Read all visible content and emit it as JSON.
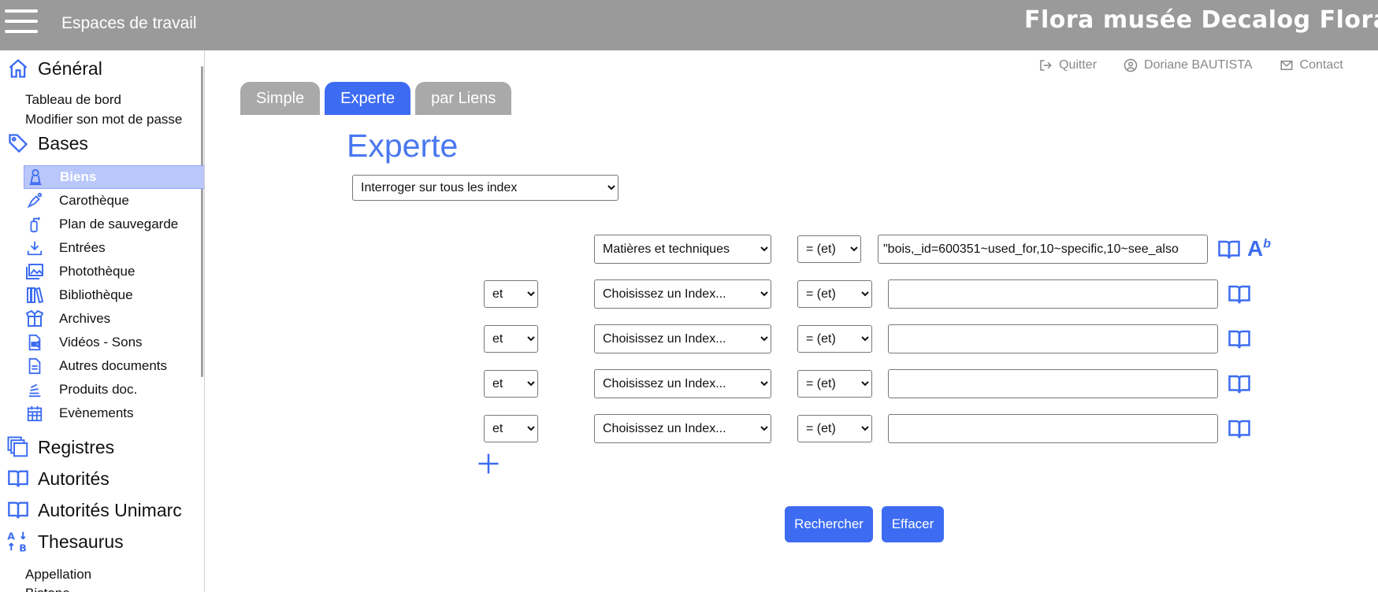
{
  "header": {
    "workspaces_label": "Espaces de travail",
    "app_title": "Flora musée Decalog Flora D"
  },
  "sidebar": {
    "general": {
      "label": "Général",
      "links": [
        "Tableau de bord",
        "Modifier son mot de passe"
      ]
    },
    "bases": {
      "label": "Bases",
      "items": [
        {
          "label": "Biens",
          "icon": "statue-icon",
          "active": true
        },
        {
          "label": "Carothèque",
          "icon": "pen-icon"
        },
        {
          "label": "Plan de sauvegarde",
          "icon": "fire-extinguisher-icon"
        },
        {
          "label": "Entrées",
          "icon": "download-tray-icon"
        },
        {
          "label": "Photothèque",
          "icon": "photos-icon"
        },
        {
          "label": "Bibliothèque",
          "icon": "books-icon"
        },
        {
          "label": "Archives",
          "icon": "open-box-icon"
        },
        {
          "label": "Vidéos - Sons",
          "icon": "video-file-icon"
        },
        {
          "label": "Autres documents",
          "icon": "document-icon"
        },
        {
          "label": "Produits doc.",
          "icon": "stack-icon"
        },
        {
          "label": "Evènements",
          "icon": "calendar-icon"
        }
      ]
    },
    "registres": "Registres",
    "autorites": "Autorités",
    "autorites_unimarc": "Autorités Unimarc",
    "thesaurus": {
      "label": "Thesaurus",
      "links": [
        "Appellation",
        "Bistone"
      ]
    }
  },
  "user_links": {
    "quit": "Quitter",
    "user": "Doriane BAUTISTA",
    "contact": "Contact"
  },
  "tabs": [
    "Simple",
    "Experte",
    "par Liens"
  ],
  "active_tab": "Experte",
  "page_title": "Experte",
  "index_scope": "Interroger sur tous les index",
  "query_rows": [
    {
      "operator": "",
      "field": "Matières et techniques",
      "comparator": "= (et)",
      "value": "\"bois,_id=600351~used_for,10~specific,10~see_also"
    },
    {
      "operator": "et",
      "field": "Choisissez un Index...",
      "comparator": "= (et)",
      "value": ""
    },
    {
      "operator": "et",
      "field": "Choisissez un Index...",
      "comparator": "= (et)",
      "value": ""
    },
    {
      "operator": "et",
      "field": "Choisissez un Index...",
      "comparator": "= (et)",
      "value": ""
    },
    {
      "operator": "et",
      "field": "Choisissez un Index...",
      "comparator": "= (et)",
      "value": ""
    }
  ],
  "ab_icon": {
    "main": "A",
    "sup": "b"
  },
  "buttons": {
    "search": "Rechercher",
    "clear": "Effacer"
  },
  "colors": {
    "accent": "#3d6cf2",
    "topbar": "#9a9a9a",
    "active_item": "#b9c7fb",
    "tab_inactive": "#a9a9a9"
  }
}
